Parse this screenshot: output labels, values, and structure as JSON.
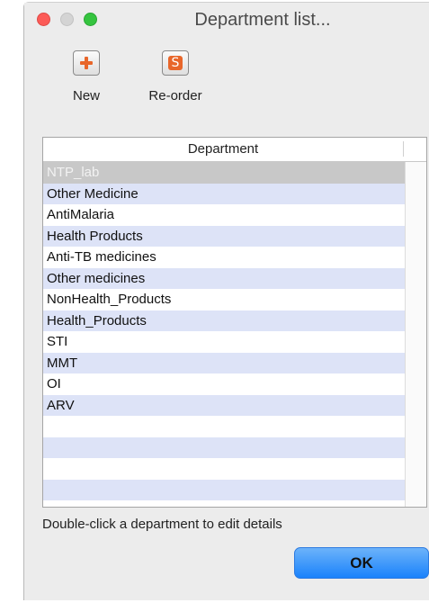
{
  "window": {
    "title": "Department list..."
  },
  "toolbar": {
    "new_label": "New",
    "reorder_label": "Re-order"
  },
  "table": {
    "column_header": "Department",
    "rows": [
      "NTP_lab",
      "Other Medicine",
      "AntiMalaria",
      "Health Products",
      "Anti-TB medicines",
      "Other medicines",
      "NonHealth_Products",
      "Health_Products",
      "STI",
      "MMT",
      "OI",
      "ARV"
    ],
    "selected_index": 0
  },
  "hint": "Double-click a department to edit details",
  "ok_label": "OK",
  "colors": {
    "accent": "#1a82fb",
    "row_alt": "#dde3f7",
    "icon": "#e8662a"
  },
  "icons": [
    "add-icon",
    "reorder-icon"
  ]
}
